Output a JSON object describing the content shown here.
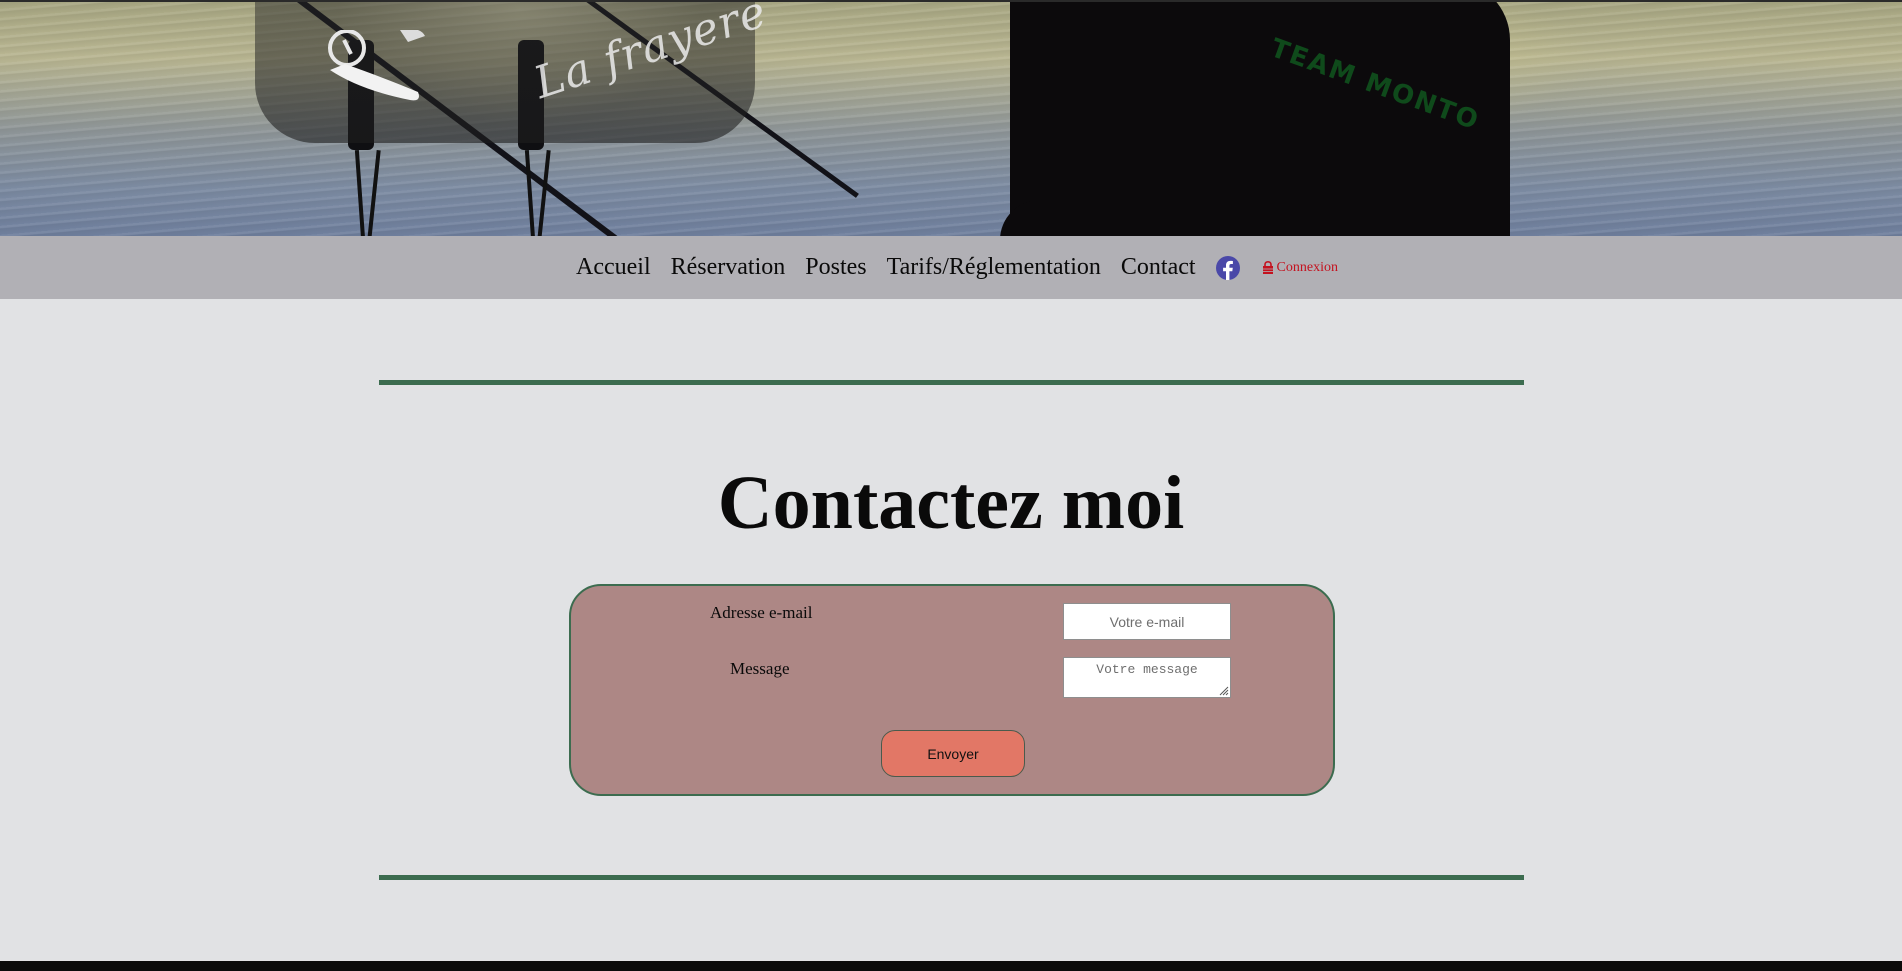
{
  "banner": {
    "logo_text": "La frayere",
    "jacket_text": "TEAM MONTO"
  },
  "nav": {
    "items": [
      {
        "label": "Accueil"
      },
      {
        "label": "Réservation"
      },
      {
        "label": "Postes"
      },
      {
        "label": "Tarifs/Réglementation"
      },
      {
        "label": "Contact"
      }
    ],
    "facebook_icon": "facebook-icon",
    "facebook_color": "#4a48a8",
    "login_icon": "lock-icon",
    "login_label": "Connexion",
    "login_color": "#c4121f"
  },
  "main": {
    "title": "Contactez moi",
    "form": {
      "email_label": "Adresse e-mail",
      "email_placeholder": "Votre e-mail",
      "email_value": "",
      "message_label": "Message",
      "message_placeholder": "Votre message",
      "message_value": "",
      "submit_label": "Envoyer"
    }
  },
  "colors": {
    "accent_rule": "#3c6c4f",
    "card_bg": "#ad8785",
    "button_bg": "#e27766",
    "nav_bg": "#b1b0b5",
    "page_bg": "#e1e2e4"
  }
}
